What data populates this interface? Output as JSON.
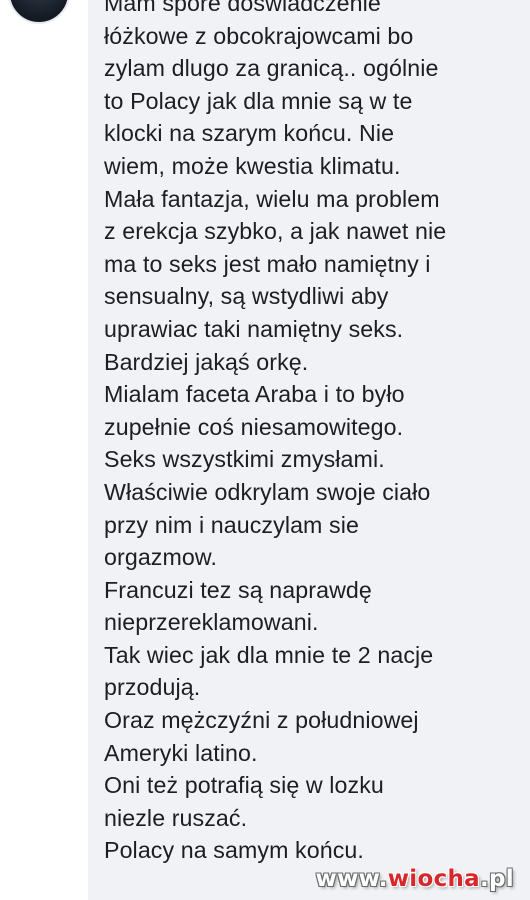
{
  "comment": {
    "lines": [
      "Mam spore doświadczenie",
      "łóżkowe z obcokrajowcami bo",
      "zylam dlugo za granicą.. ogólnie",
      "to Polacy jak dla mnie są w te",
      "klocki na szarym końcu. Nie",
      "wiem, może kwestia klimatu.",
      "Mała fantazja, wielu ma problem",
      "z erekcja szybko, a jak nawet nie",
      "ma to seks jest mało namiętny i",
      "sensualny, są wstydliwi aby",
      "uprawiac taki namiętny seks.",
      "Bardziej jakąś orkę.",
      "Mialam faceta Araba i to było",
      "zupełnie coś niesamowitego.",
      "Seks wszystkimi zmysłami.",
      "Właściwie odkrylam swoje ciało",
      "przy nim i nauczylam sie",
      "orgazmow.",
      "Francuzi tez są naprawdę",
      "nieprzereklamowani.",
      "Tak wiec jak dla mnie te 2 nacje",
      "przodują.",
      "Oraz mężczyźni z południowej",
      "Ameryki latino.",
      "Oni też potrafią się w lozku",
      "niezle ruszać.",
      "Polacy na samym końcu."
    ]
  },
  "watermark": {
    "www": "www.",
    "name": "wiocha",
    "tld": ".pl"
  },
  "colors": {
    "bubble": "#f0f2f5",
    "text": "#1c1e21",
    "watermark_red": "#d8262b"
  }
}
